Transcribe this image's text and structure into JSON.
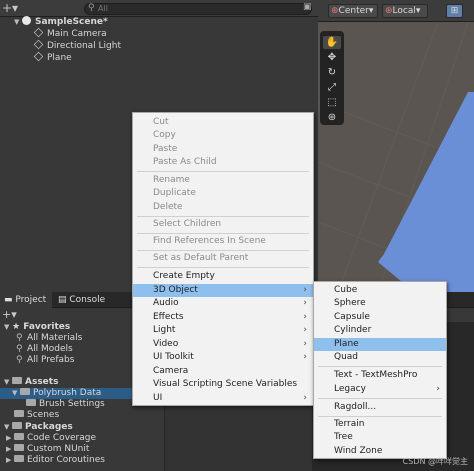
{
  "hierarchy": {
    "search_placeholder": "All",
    "scene_name": "SampleScene*",
    "objects": [
      "Main Camera",
      "Directional Light",
      "Plane"
    ]
  },
  "scene_toolbar": {
    "pivot": "Center",
    "space": "Local"
  },
  "bottom_tabs": {
    "project": "Project",
    "console": "Console"
  },
  "project_tree": {
    "favorites_label": "Favorites",
    "favorites": [
      "All Materials",
      "All Models",
      "All Prefabs"
    ],
    "assets_label": "Assets",
    "assets": [
      "Polybrush Data",
      "Brush Settings",
      "Scenes"
    ],
    "packages_label": "Packages",
    "packages": [
      "Code Coverage",
      "Custom NUnit",
      "Editor Coroutines"
    ]
  },
  "context_menu": {
    "items": [
      {
        "label": "Cut",
        "disabled": true
      },
      {
        "label": "Copy",
        "disabled": true
      },
      {
        "label": "Paste",
        "disabled": true
      },
      {
        "label": "Paste As Child",
        "disabled": true
      },
      {
        "label": "Rename",
        "disabled": true
      },
      {
        "label": "Duplicate",
        "disabled": true
      },
      {
        "label": "Delete",
        "disabled": true
      },
      {
        "label": "Select Children",
        "disabled": true
      },
      {
        "label": "Find References In Scene",
        "disabled": true
      },
      {
        "label": "Set as Default Parent",
        "disabled": true
      },
      {
        "label": "Create Empty",
        "disabled": false
      },
      {
        "label": "3D Object",
        "disabled": false,
        "submenu": true,
        "highlighted": true
      },
      {
        "label": "Audio",
        "disabled": false,
        "submenu": true
      },
      {
        "label": "Effects",
        "disabled": false,
        "submenu": true
      },
      {
        "label": "Light",
        "disabled": false,
        "submenu": true
      },
      {
        "label": "Video",
        "disabled": false,
        "submenu": true
      },
      {
        "label": "UI Toolkit",
        "disabled": false,
        "submenu": true
      },
      {
        "label": "Camera",
        "disabled": false
      },
      {
        "label": "Visual Scripting Scene Variables",
        "disabled": false
      },
      {
        "label": "UI",
        "disabled": false,
        "submenu": true
      }
    ]
  },
  "submenu_3d": {
    "items": [
      {
        "label": "Cube"
      },
      {
        "label": "Sphere"
      },
      {
        "label": "Capsule"
      },
      {
        "label": "Cylinder"
      },
      {
        "label": "Plane",
        "highlighted": true
      },
      {
        "label": "Quad"
      },
      {
        "label": "Text - TextMeshPro"
      },
      {
        "label": "Legacy",
        "submenu": true
      },
      {
        "label": "Ragdoll..."
      },
      {
        "label": "Terrain"
      },
      {
        "label": "Tree"
      },
      {
        "label": "Wind Zone"
      }
    ]
  },
  "watermark": "CSDN @咩咩觉主",
  "colors": {
    "menu_bg": "#f2f2f2",
    "menu_highlight": "#8fbfec",
    "selection_blue": "#2c5d87",
    "plane_blue": "#6b8fd6",
    "scene_bg": "#5a5550"
  }
}
